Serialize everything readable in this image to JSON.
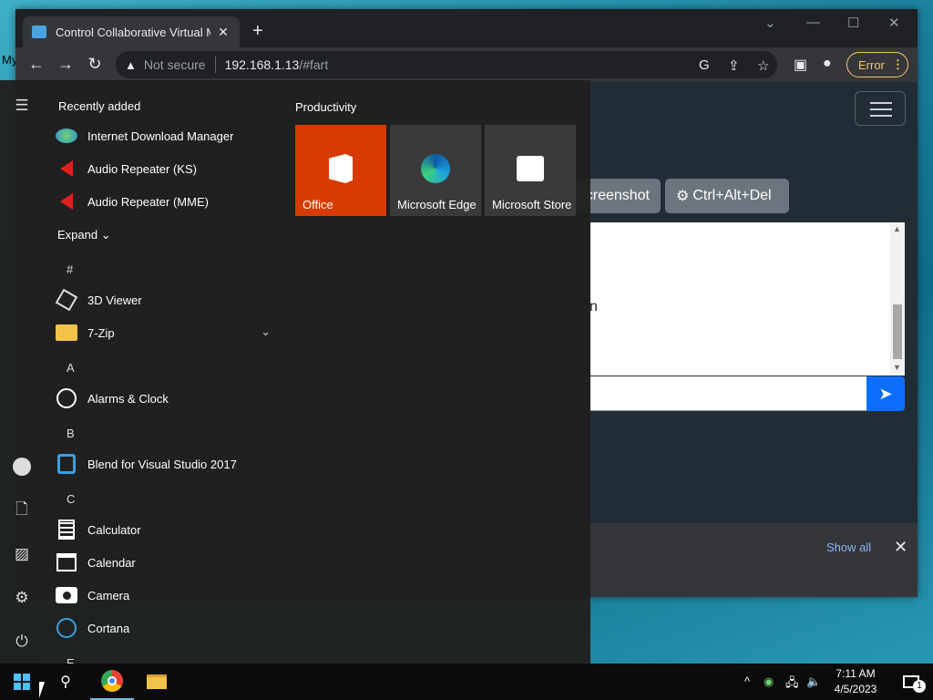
{
  "desktop": {
    "label": "My"
  },
  "browser": {
    "tab_title": "Control Collaborative Virtual Ma",
    "tab_close": "✕",
    "new_tab": "+",
    "window_controls": {
      "chevron": "⌄",
      "minimize": "—",
      "maximize": "☐",
      "close": "✕"
    },
    "nav": {
      "back": "←",
      "forward": "→",
      "reload": "↻"
    },
    "warning_icon": "▲",
    "not_secure": "Not secure",
    "url_host": "192.168.1.13",
    "url_path": "/#fart",
    "error_label": "Error",
    "error_menu": "⋮"
  },
  "page": {
    "screenshot_button": "creenshot",
    "cad_button": "Ctrl+Alt+Del",
    "cad_icon": "⚙",
    "textarea_fragment": "n",
    "send_icon": "➤",
    "download_bar": {
      "show_all": "Show all",
      "close": "✕"
    }
  },
  "start_menu": {
    "recently_added_header": "Recently added",
    "recent_apps": [
      {
        "name": "Internet Download Manager",
        "icon": "idm-icon"
      },
      {
        "name": "Audio Repeater (KS)",
        "icon": "speaker-icon"
      },
      {
        "name": "Audio Repeater (MME)",
        "icon": "speaker-icon"
      }
    ],
    "expand_label": "Expand",
    "expand_chevron": "⌄",
    "groups": [
      {
        "letter": "#",
        "apps": [
          {
            "name": "3D Viewer",
            "icon": "cube-icon"
          },
          {
            "name": "7-Zip",
            "icon": "folder-icon",
            "expandable": true
          }
        ]
      },
      {
        "letter": "A",
        "apps": [
          {
            "name": "Alarms & Clock",
            "icon": "clock-icon"
          }
        ]
      },
      {
        "letter": "B",
        "apps": [
          {
            "name": "Blend for Visual Studio 2017",
            "icon": "blend-icon"
          }
        ]
      },
      {
        "letter": "C",
        "apps": [
          {
            "name": "Calculator",
            "icon": "calculator-icon"
          },
          {
            "name": "Calendar",
            "icon": "calendar-icon"
          },
          {
            "name": "Camera",
            "icon": "camera-icon"
          },
          {
            "name": "Cortana",
            "icon": "cortana-icon"
          }
        ]
      }
    ],
    "next_letter": "E",
    "productivity_header": "Productivity",
    "tiles": [
      {
        "name": "Office",
        "color": "#d83b01"
      },
      {
        "name": "Microsoft Edge",
        "color": "#3a3a3a"
      },
      {
        "name": "Microsoft Store",
        "color": "#3a3a3a"
      }
    ]
  },
  "taskbar": {
    "time": "7:11 AM",
    "date": "4/5/2023",
    "notification_count": "1",
    "tray_caret": "^"
  }
}
